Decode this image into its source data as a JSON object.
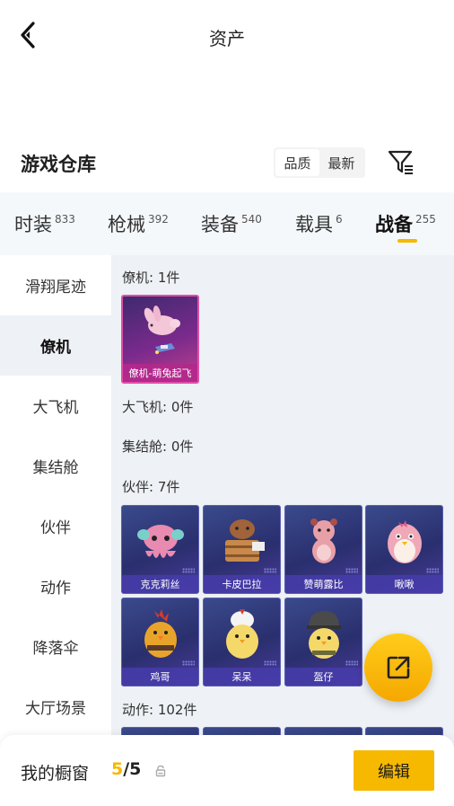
{
  "header": {
    "title": "资产",
    "back_icon": "chevron-left-icon"
  },
  "warehouse": {
    "title": "游戏仓库",
    "sort_options": [
      "品质",
      "最新"
    ],
    "sort_selected": "品质",
    "filter_icon": "filter-icon"
  },
  "tabs": [
    {
      "label": "时装",
      "count": "833"
    },
    {
      "label": "枪械",
      "count": "392"
    },
    {
      "label": "装备",
      "count": "540"
    },
    {
      "label": "载具",
      "count": "6"
    },
    {
      "label": "战备",
      "count": "255",
      "active": true
    }
  ],
  "sidebar": {
    "items": [
      "滑翔尾迹",
      "僚机",
      "大飞机",
      "集结舱",
      "伙伴",
      "动作",
      "降落伞",
      "大厅场景"
    ],
    "active": "僚机"
  },
  "sections": [
    {
      "title": "僚机: 1件",
      "items": [
        {
          "name": "僚机-萌兔起飞",
          "rarity": "pink"
        }
      ]
    },
    {
      "title": "大飞机: 0件",
      "items": []
    },
    {
      "title": "集结舱: 0件",
      "items": []
    },
    {
      "title": "伙伴: 7件",
      "items": [
        {
          "name": "克克莉丝",
          "icon": "octopus-icon"
        },
        {
          "name": "卡皮巴拉",
          "icon": "capybara-icon"
        },
        {
          "name": "赞萌露比",
          "icon": "beaver-icon"
        },
        {
          "name": "啾啾",
          "icon": "bird-icon"
        },
        {
          "name": "鸡哥",
          "icon": "rooster-icon"
        },
        {
          "name": "呆呆",
          "icon": "chick-icon"
        },
        {
          "name": "盔仔",
          "icon": "helmet-chick-icon"
        }
      ]
    },
    {
      "title": "动作: 102件",
      "items": []
    }
  ],
  "share_icon": "share-external-icon",
  "bottom_bar": {
    "label": "我的橱窗",
    "current": "5",
    "total": "/5",
    "lock_icon": "lock-icon",
    "edit_label": "编辑"
  },
  "colors": {
    "accent": "#f5b800",
    "pink_rarity": "#e04fa8",
    "purple_rarity": "#5a5fb4"
  }
}
